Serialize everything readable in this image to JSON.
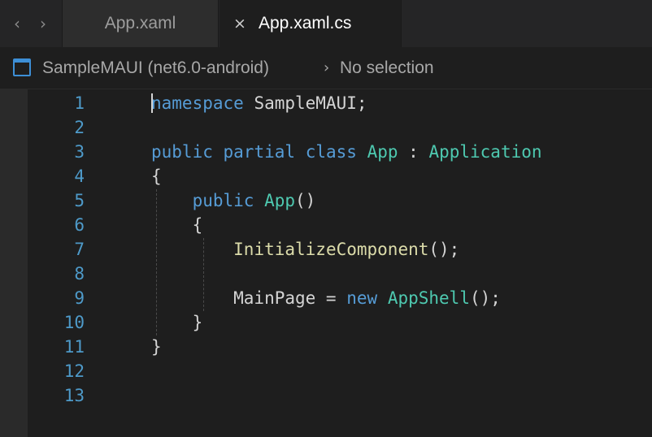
{
  "nav": {
    "back_icon": "chevron-left-icon",
    "forward_icon": "chevron-right-icon",
    "back_glyph": "‹",
    "forward_glyph": "›"
  },
  "tabs": [
    {
      "label": "App.xaml",
      "active": false
    },
    {
      "label": "App.xaml.cs",
      "active": true,
      "close_glyph": "×"
    }
  ],
  "breadcrumb": {
    "project": "SampleMAUI (net6.0-android)",
    "separator": "›",
    "selection": "No selection"
  },
  "editor": {
    "line_numbers": [
      "1",
      "2",
      "3",
      "4",
      "5",
      "6",
      "7",
      "8",
      "9",
      "10",
      "11",
      "12",
      "13"
    ],
    "lines": [
      [
        {
          "t": "namespace",
          "c": "kw"
        },
        {
          "t": " SampleMAUI;",
          "c": "plain"
        }
      ],
      [],
      [
        {
          "t": "public",
          "c": "kw"
        },
        {
          "t": " ",
          "c": "plain"
        },
        {
          "t": "partial",
          "c": "kw"
        },
        {
          "t": " ",
          "c": "plain"
        },
        {
          "t": "class",
          "c": "kw"
        },
        {
          "t": " ",
          "c": "plain"
        },
        {
          "t": "App",
          "c": "type"
        },
        {
          "t": " : ",
          "c": "plain"
        },
        {
          "t": "Application",
          "c": "type"
        }
      ],
      [
        {
          "t": "{",
          "c": "plain"
        }
      ],
      [
        {
          "t": "    ",
          "c": "plain"
        },
        {
          "t": "public",
          "c": "kw"
        },
        {
          "t": " ",
          "c": "plain"
        },
        {
          "t": "App",
          "c": "type"
        },
        {
          "t": "()",
          "c": "plain"
        }
      ],
      [
        {
          "t": "    {",
          "c": "plain"
        }
      ],
      [
        {
          "t": "        ",
          "c": "plain"
        },
        {
          "t": "InitializeComponent",
          "c": "fn"
        },
        {
          "t": "();",
          "c": "plain"
        }
      ],
      [],
      [
        {
          "t": "        MainPage = ",
          "c": "plain"
        },
        {
          "t": "new",
          "c": "kw"
        },
        {
          "t": " ",
          "c": "plain"
        },
        {
          "t": "AppShell",
          "c": "type"
        },
        {
          "t": "();",
          "c": "plain"
        }
      ],
      [
        {
          "t": "    }",
          "c": "plain"
        }
      ],
      [
        {
          "t": "}",
          "c": "plain"
        }
      ],
      [],
      []
    ]
  },
  "colors": {
    "keyword": "#569cd6",
    "type": "#4ec9b0",
    "method": "#dcdcaa",
    "text": "#d4d4d4",
    "line_number": "#4e9ac9",
    "background": "#1e1e1e"
  }
}
